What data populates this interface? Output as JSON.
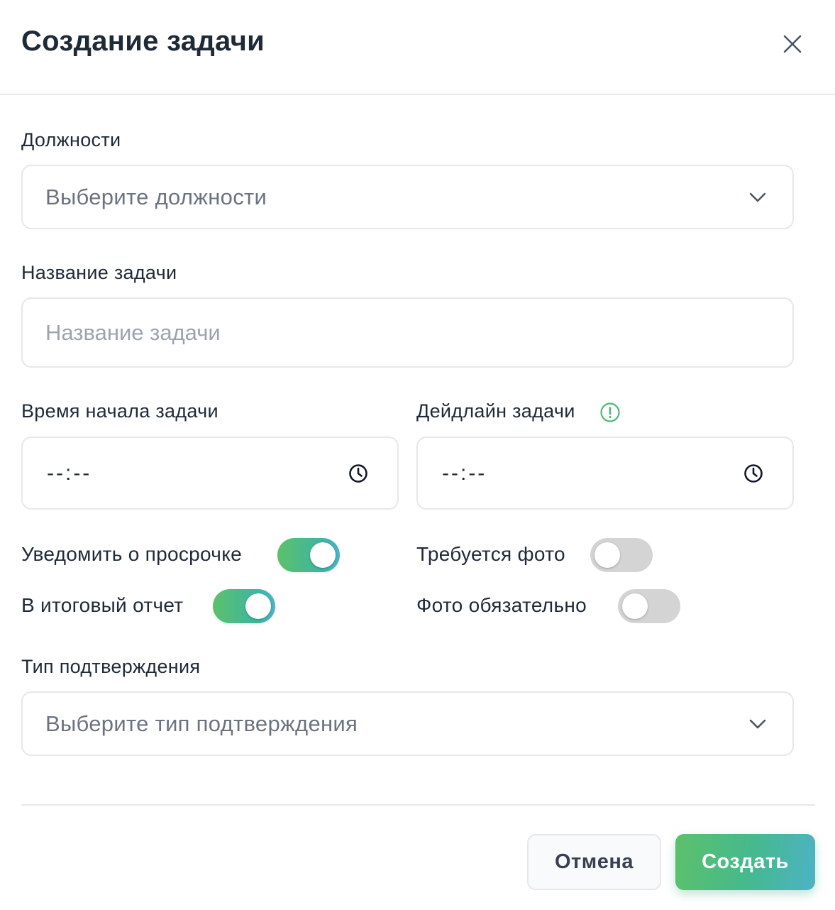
{
  "dialog": {
    "title": "Создание задачи",
    "close_icon": "close-icon"
  },
  "positions": {
    "label": "Должности",
    "placeholder": "Выберите должности",
    "icon": "chevron-down-icon"
  },
  "task_name": {
    "label": "Название задачи",
    "placeholder": "Название задачи",
    "value": ""
  },
  "start_time": {
    "label": "Время начала задачи",
    "value": "--:--",
    "icon": "clock-icon"
  },
  "deadline": {
    "label": "Дейдлайн задачи",
    "value": "--:--",
    "icon": "clock-icon",
    "info_icon": "info-icon"
  },
  "toggles": {
    "notify_overdue": {
      "label": "Уведомить о просрочке",
      "on": true
    },
    "in_final_report": {
      "label": "В итоговый отчет",
      "on": true
    },
    "photo_required": {
      "label": "Требуется фото",
      "on": false
    },
    "photo_mandatory": {
      "label": "Фото обязательно",
      "on": false
    }
  },
  "confirmation_type": {
    "label": "Тип подтверждения",
    "placeholder": "Выберите тип подтверждения",
    "icon": "chevron-down-icon"
  },
  "footer": {
    "cancel_label": "Отмена",
    "create_label": "Создать"
  },
  "colors": {
    "accent_start": "#5cc16a",
    "accent_end": "#4db3c6",
    "text_primary": "#1f2a37",
    "text_muted": "#6b7280",
    "border": "#e5e7eb",
    "toggle_off": "#d4d4d4"
  }
}
